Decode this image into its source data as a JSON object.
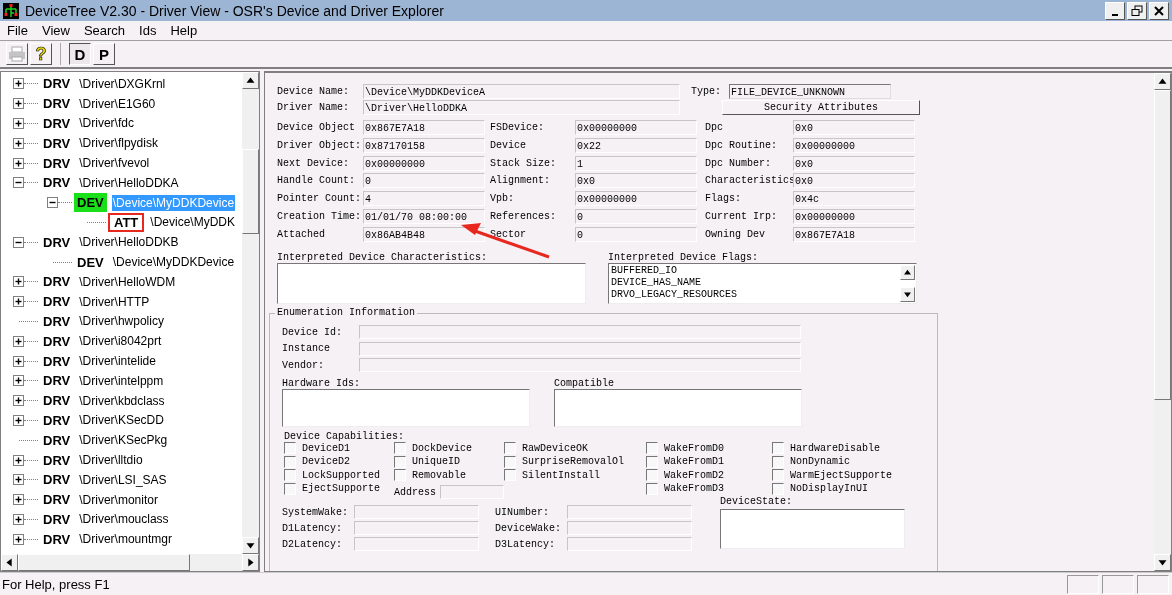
{
  "window": {
    "title": "DeviceTree V2.30 - Driver View - OSR's Device and Driver Explorer"
  },
  "menu": [
    "File",
    "View",
    "Search",
    "Ids",
    "Help"
  ],
  "toolbar": [
    {
      "kind": "print",
      "disabled": true
    },
    {
      "kind": "help",
      "label": "?"
    },
    {
      "kind": "view",
      "label": "D",
      "selected": true
    },
    {
      "kind": "view",
      "label": "P",
      "selected": false
    }
  ],
  "tree": {
    "nodes": [
      {
        "tag": "DRV",
        "path": "\\Driver\\DXGKrnl",
        "expandable": true,
        "expanded": false,
        "selected": false,
        "annotated": false
      },
      {
        "tag": "DRV",
        "path": "\\Driver\\E1G60",
        "expandable": true,
        "expanded": false,
        "selected": false,
        "annotated": false
      },
      {
        "tag": "DRV",
        "path": "\\Driver\\fdc",
        "expandable": true,
        "expanded": false,
        "selected": false,
        "annotated": false
      },
      {
        "tag": "DRV",
        "path": "\\Driver\\flpydisk",
        "expandable": true,
        "expanded": false,
        "selected": false,
        "annotated": false
      },
      {
        "tag": "DRV",
        "path": "\\Driver\\fvevol",
        "expandable": true,
        "expanded": false,
        "selected": false,
        "annotated": false
      },
      {
        "tag": "DRV",
        "path": "\\Driver\\HelloDDKA",
        "expandable": true,
        "expanded": true,
        "selected": false,
        "annotated": false,
        "children": [
          {
            "tag": "DEV",
            "path": "\\Device\\MyDDKDevice",
            "expandable": true,
            "expanded": true,
            "selected": true,
            "annotated": false,
            "children": [
              {
                "tag": "ATT",
                "path": "\\Device\\MyDDK",
                "expandable": false,
                "selected": false,
                "annotated": true
              }
            ]
          }
        ]
      },
      {
        "tag": "DRV",
        "path": "\\Driver\\HelloDDKB",
        "expandable": true,
        "expanded": true,
        "selected": false,
        "annotated": false,
        "children": [
          {
            "tag": "DEV",
            "path": "\\Device\\MyDDKDevice",
            "expandable": false,
            "selected": false,
            "annotated": false
          }
        ]
      },
      {
        "tag": "DRV",
        "path": "\\Driver\\HelloWDM",
        "expandable": true,
        "expanded": false,
        "selected": false,
        "annotated": false
      },
      {
        "tag": "DRV",
        "path": "\\Driver\\HTTP",
        "expandable": true,
        "expanded": false,
        "selected": false,
        "annotated": false
      },
      {
        "tag": "DRV",
        "path": "\\Driver\\hwpolicy",
        "expandable": false,
        "selected": false,
        "annotated": false
      },
      {
        "tag": "DRV",
        "path": "\\Driver\\i8042prt",
        "expandable": true,
        "expanded": false,
        "selected": false,
        "annotated": false
      },
      {
        "tag": "DRV",
        "path": "\\Driver\\intelide",
        "expandable": true,
        "expanded": false,
        "selected": false,
        "annotated": false
      },
      {
        "tag": "DRV",
        "path": "\\Driver\\intelppm",
        "expandable": true,
        "expanded": false,
        "selected": false,
        "annotated": false
      },
      {
        "tag": "DRV",
        "path": "\\Driver\\kbdclass",
        "expandable": true,
        "expanded": false,
        "selected": false,
        "annotated": false
      },
      {
        "tag": "DRV",
        "path": "\\Driver\\KSecDD",
        "expandable": true,
        "expanded": false,
        "selected": false,
        "annotated": false
      },
      {
        "tag": "DRV",
        "path": "\\Driver\\KSecPkg",
        "expandable": false,
        "selected": false,
        "annotated": false
      },
      {
        "tag": "DRV",
        "path": "\\Driver\\lltdio",
        "expandable": true,
        "expanded": false,
        "selected": false,
        "annotated": false
      },
      {
        "tag": "DRV",
        "path": "\\Driver\\LSI_SAS",
        "expandable": true,
        "expanded": false,
        "selected": false,
        "annotated": false
      },
      {
        "tag": "DRV",
        "path": "\\Driver\\monitor",
        "expandable": true,
        "expanded": false,
        "selected": false,
        "annotated": false
      },
      {
        "tag": "DRV",
        "path": "\\Driver\\mouclass",
        "expandable": true,
        "expanded": false,
        "selected": false,
        "annotated": false
      },
      {
        "tag": "DRV",
        "path": "\\Driver\\mountmgr",
        "expandable": true,
        "expanded": false,
        "selected": false,
        "annotated": false
      }
    ]
  },
  "details": {
    "name_fields": [
      {
        "label": "Device Name:",
        "value": "\\Device\\MyDDKDeviceA"
      },
      {
        "label": "Driver Name:",
        "value": "\\Driver\\HelloDDKA"
      }
    ],
    "type": {
      "label": "Type:",
      "value": "FILE_DEVICE_UNKNOWN"
    },
    "security_button": "Security Attributes",
    "columns": [
      [
        {
          "label": "Device Object",
          "value": "0x867E7A18"
        },
        {
          "label": "Driver Object:",
          "value": "0x87170158"
        },
        {
          "label": "Next Device:",
          "value": "0x00000000"
        },
        {
          "label": "Handle Count:",
          "value": "0"
        },
        {
          "label": "Pointer Count:",
          "value": "4"
        },
        {
          "label": "Creation Time:",
          "value": "01/01/70 08:00:00"
        },
        {
          "label": "Attached",
          "value": "0x86AB4B48"
        }
      ],
      [
        {
          "label": "FSDevice:",
          "value": "0x00000000"
        },
        {
          "label": "Device",
          "value": "0x22"
        },
        {
          "label": "Stack Size:",
          "value": "1"
        },
        {
          "label": "Alignment:",
          "value": "0x0"
        },
        {
          "label": "Vpb:",
          "value": "0x00000000"
        },
        {
          "label": "References:",
          "value": "0"
        },
        {
          "label": "Sector",
          "value": "0"
        }
      ],
      [
        {
          "label": "Dpc",
          "value": "0x0"
        },
        {
          "label": "Dpc Routine:",
          "value": "0x00000000"
        },
        {
          "label": "Dpc Number:",
          "value": "0x0"
        },
        {
          "label": "Characteristics",
          "value": "0x0"
        },
        {
          "label": "Flags:",
          "value": "0x4c"
        },
        {
          "label": "Current Irp:",
          "value": "0x00000000"
        },
        {
          "label": "Owning Dev",
          "value": "0x867E7A18"
        }
      ]
    ],
    "characteristics": {
      "label": "Interpreted Device Characteristics:"
    },
    "flags": {
      "label": "Interpreted Device Flags:",
      "items": [
        "BUFFERED_IO",
        "DEVICE_HAS_NAME",
        "DRVO_LEGACY_RESOURCES"
      ]
    },
    "enumeration": {
      "title": "Enumeration Information",
      "fields": [
        {
          "label": "Device Id:"
        },
        {
          "label": "Instance"
        },
        {
          "label": "Vendor:"
        }
      ],
      "hardware_ids": {
        "label": "Hardware Ids:"
      },
      "compatible": {
        "label": "Compatible"
      },
      "capabilities": {
        "label": "Device Capabilities:",
        "columns": [
          [
            {
              "label": "DeviceD1",
              "checked": false
            },
            {
              "label": "DeviceD2",
              "checked": false
            },
            {
              "label": "LockSupported",
              "checked": false
            },
            {
              "label": "EjectSupporte",
              "checked": false
            }
          ],
          [
            {
              "label": "DockDevice",
              "checked": false
            },
            {
              "label": "UniqueID",
              "checked": false
            },
            {
              "label": "Removable",
              "checked": false
            }
          ],
          [
            {
              "label": "RawDeviceOK",
              "checked": false
            },
            {
              "label": "SurpriseRemovalOl",
              "checked": false
            },
            {
              "label": "SilentInstall",
              "checked": false
            }
          ],
          [
            {
              "label": "WakeFromD0",
              "checked": false
            },
            {
              "label": "WakeFromD1",
              "checked": false
            },
            {
              "label": "WakeFromD2",
              "checked": false
            },
            {
              "label": "WakeFromD3",
              "checked": false
            }
          ],
          [
            {
              "label": "HardwareDisable",
              "checked": false
            },
            {
              "label": "NonDynamic",
              "checked": false
            },
            {
              "label": "WarmEjectSupporte",
              "checked": false
            },
            {
              "label": "NoDisplayInUI",
              "checked": false
            }
          ]
        ]
      },
      "address": {
        "label": "Address"
      },
      "power_columns": [
        [
          {
            "label": "SystemWake:"
          },
          {
            "label": "D1Latency:"
          },
          {
            "label": "D2Latency:"
          }
        ],
        [
          {
            "label": "UINumber:"
          },
          {
            "label": "DeviceWake:"
          },
          {
            "label": "D3Latency:"
          }
        ]
      ],
      "device_state": {
        "label": "DeviceState:"
      }
    }
  },
  "status_bar": {
    "text": "For Help, press F1"
  }
}
